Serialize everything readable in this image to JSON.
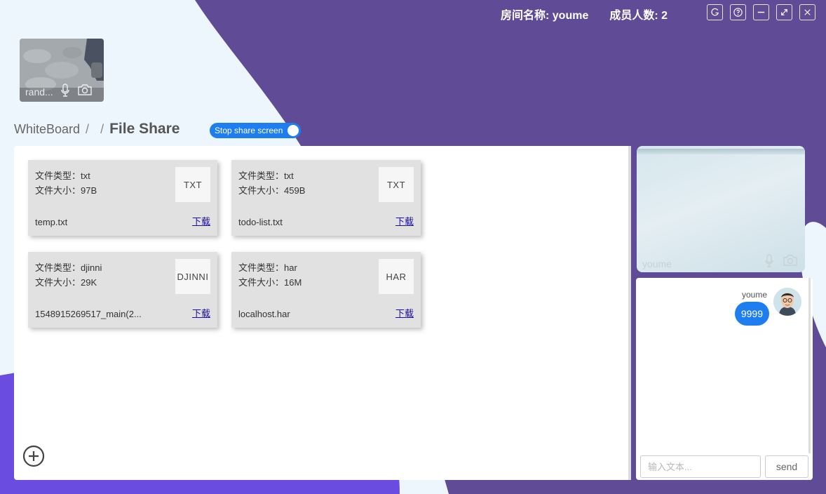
{
  "header": {
    "room_name": "房间名称: youme",
    "member_count": "成员人数: 2",
    "window_buttons": [
      "refresh-icon",
      "help-icon",
      "minimize-icon",
      "fullscreen-icon",
      "close-icon"
    ]
  },
  "local_video": {
    "label": "rand...",
    "icons": [
      "microphone-icon",
      "camera-icon"
    ]
  },
  "breadcrumb": {
    "root": "WhiteBoard",
    "sep1": "/",
    "sep2": "/",
    "current": "File Share"
  },
  "share_toggle": {
    "label": "Stop share screen",
    "on": true
  },
  "files": [
    {
      "type_line": "文件类型：txt",
      "size_line": "文件大小：97B",
      "thumb": "TXT",
      "name": "temp.txt",
      "download": "下载"
    },
    {
      "type_line": "文件类型：txt",
      "size_line": "文件大小：459B",
      "thumb": "TXT",
      "name": "todo-list.txt",
      "download": "下载"
    },
    {
      "type_line": "文件类型：djinni",
      "size_line": "文件大小：29K",
      "thumb": "DJINNI",
      "name": "1548915269517_main(2...",
      "download": "下载"
    },
    {
      "type_line": "文件类型：har",
      "size_line": "文件大小：16M",
      "thumb": "HAR",
      "name": "localhost.har",
      "download": "下载"
    }
  ],
  "remote_video": {
    "label": "youme",
    "icons": [
      "microphone-icon",
      "camera-icon"
    ]
  },
  "chat": {
    "messages": [
      {
        "user": "youme",
        "text": "9999"
      }
    ],
    "input_placeholder": "输入文本...",
    "send_label": "send"
  },
  "colors": {
    "purple": "#5f4b96",
    "violet": "#6b4ce0",
    "accent_blue": "#1e7ef0",
    "page_bg": "#eef6fd"
  }
}
